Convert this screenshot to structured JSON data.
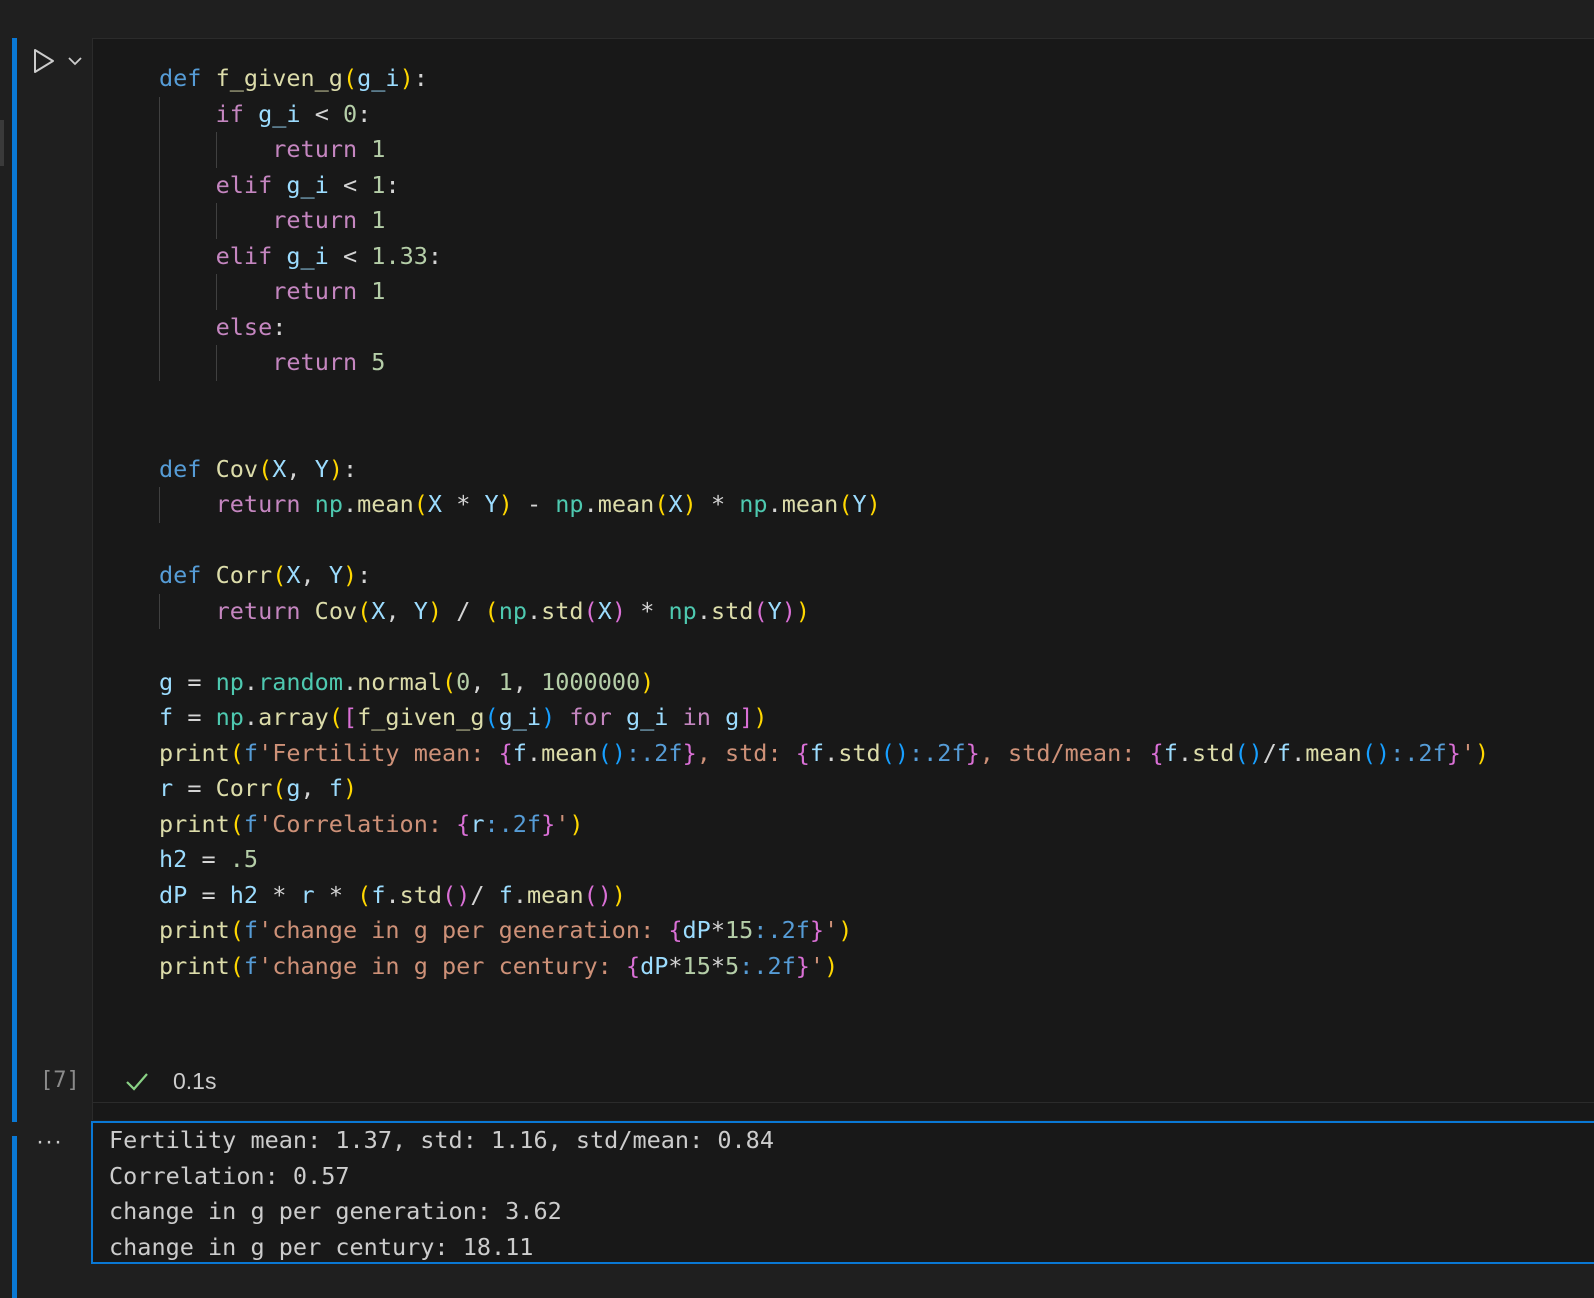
{
  "cell": {
    "execution_count": "[7]",
    "exec_time": "0.1s",
    "code_lines": [
      "def f_given_g(g_i):",
      "    if g_i < 0:",
      "        return 1",
      "    elif g_i < 1:",
      "        return 1",
      "    elif g_i < 1.33:",
      "        return 1",
      "    else:",
      "        return 5",
      "",
      "",
      "def Cov(X, Y):",
      "    return np.mean(X * Y) - np.mean(X) * np.mean(Y)",
      "",
      "def Corr(X, Y):",
      "    return Cov(X, Y) / (np.std(X) * np.std(Y))",
      "",
      "g = np.random.normal(0, 1, 1000000)",
      "f = np.array([f_given_g(g_i) for g_i in g])",
      "print(f'Fertility mean: {f.mean():.2f}, std: {f.std():.2f}, std/mean: {f.std()/f.mean():.2f}')",
      "r = Corr(g, f)",
      "print(f'Correlation: {r:.2f}')",
      "h2 = .5",
      "dP = h2 * r * (f.std()/ f.mean())",
      "print(f'change in g per generation: {dP*15:.2f}')",
      "print(f'change in g per century: {dP*15*5:.2f}')"
    ]
  },
  "output": {
    "lines": [
      "Fertility mean: 1.37, std: 1.16, std/mean: 0.84",
      "Correlation: 0.57",
      "change in g per generation: 3.62",
      "change in g per century: 18.11"
    ]
  },
  "icons": {
    "run": "play-icon",
    "run_menu": "chevron-down-icon",
    "status": "check-icon",
    "output_menu": "more-icon"
  },
  "colors": {
    "accent": "#0a78d4",
    "success": "#89d185",
    "keyword": "#569cd6",
    "control": "#c586c0",
    "function": "#dcdcaa",
    "variable": "#9cdcfe",
    "number": "#b5cea8",
    "string": "#ce9178",
    "module": "#4ec9b0"
  }
}
